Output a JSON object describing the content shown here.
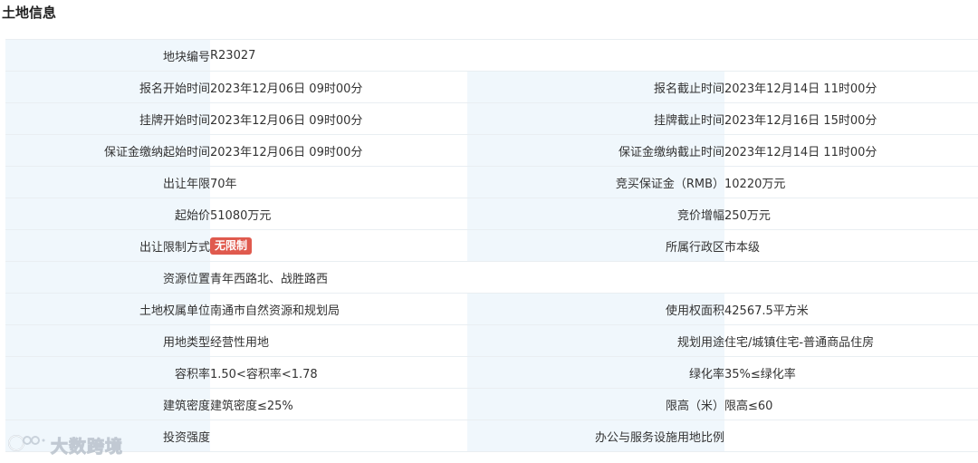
{
  "section": {
    "title": "土地信息"
  },
  "rows": [
    {
      "l1": "地块编号",
      "v1": "R23027",
      "l2": "",
      "v2": ""
    },
    {
      "l1": "报名开始时间",
      "v1": "2023年12月06日 09时00分",
      "l2": "报名截止时间",
      "v2": "2023年12月14日 11时00分"
    },
    {
      "l1": "挂牌开始时间",
      "v1": "2023年12月06日 09时00分",
      "l2": "挂牌截止时间",
      "v2": "2023年12月16日 15时00分"
    },
    {
      "l1": "保证金缴纳起始时间",
      "v1": "2023年12月06日 09时00分",
      "l2": "保证金缴纳截止时间",
      "v2": "2023年12月14日 11时00分"
    },
    {
      "l1": "出让年限",
      "v1": "70年",
      "l2": "竞买保证金（RMB）",
      "v2": "10220万元"
    },
    {
      "l1": "起始价",
      "v1": "51080万元",
      "l2": "竞价增幅",
      "v2": "250万元"
    },
    {
      "l1": "出让限制方式",
      "v1": "无限制",
      "l2": "所属行政区",
      "v2": "市本级"
    },
    {
      "l1": "资源位置",
      "v1": "青年西路北、战胜路西",
      "l2": "",
      "v2": ""
    },
    {
      "l1": "土地权属单位",
      "v1": "南通市自然资源和规划局",
      "l2": "使用权面积",
      "v2": "42567.5平方米"
    },
    {
      "l1": "用地类型",
      "v1": "经营性用地",
      "l2": "规划用途",
      "v2": "住宅/城镇住宅-普通商品住房"
    },
    {
      "l1": "容积率",
      "v1": "1.50<容积率<1.78",
      "l2": "绿化率",
      "v2": "35%≤绿化率"
    },
    {
      "l1": "建筑密度",
      "v1": "建筑密度≤25%",
      "l2": "限高（米）",
      "v2": "限高≤60"
    },
    {
      "l1": "投资强度",
      "v1": "",
      "l2": "办公与服务设施用地比例",
      "v2": ""
    }
  ],
  "watermark": {
    "text": "大数跨境",
    "icon": "dashuju-logo-icon"
  },
  "colors": {
    "label_bg": "#f0f7fc",
    "badge_bg": "#e05a4e",
    "border": "#e9eef2"
  }
}
